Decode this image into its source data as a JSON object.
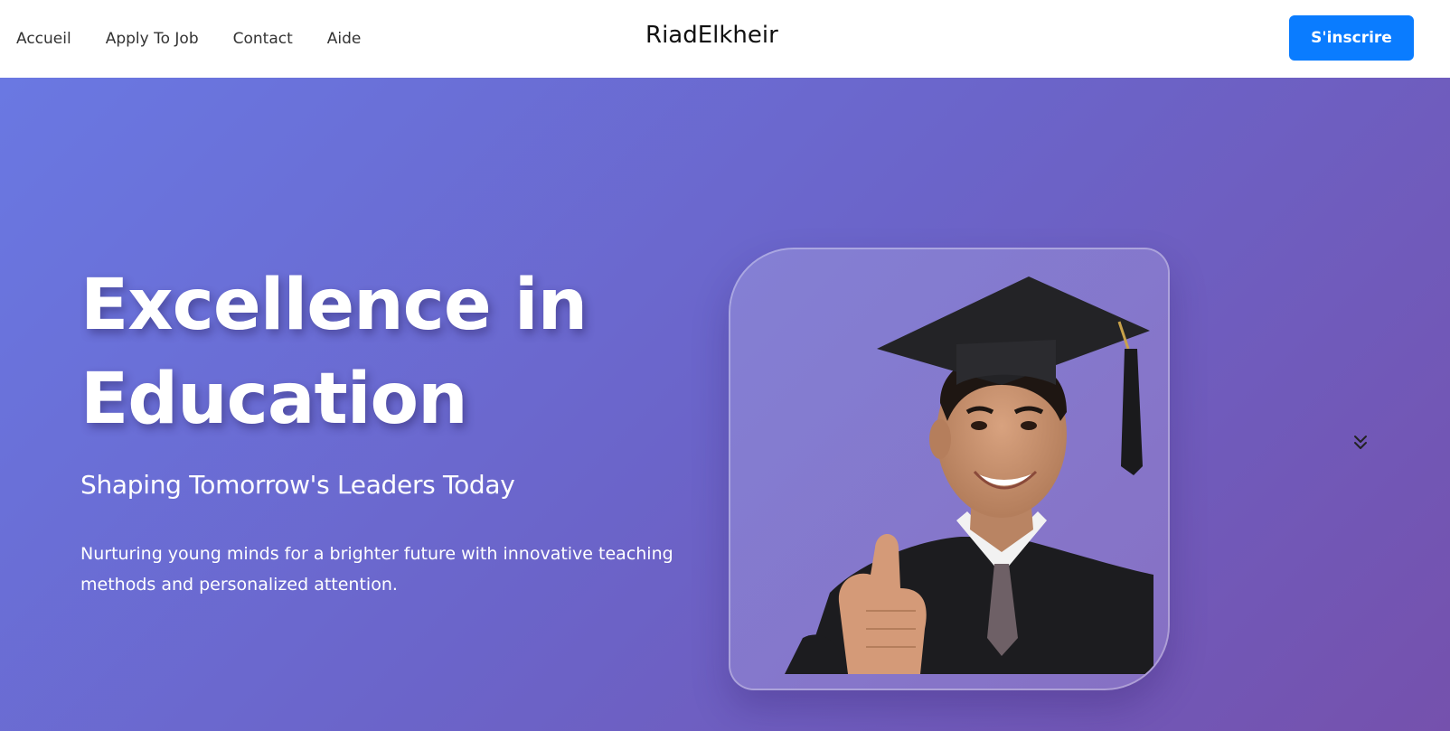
{
  "nav": {
    "links": [
      "Accueil",
      "Apply To Job",
      "Contact",
      "Aide"
    ],
    "brand": "RiadElkheir",
    "signup_label": "S'inscrire"
  },
  "hero": {
    "title": "Excellence in Education",
    "subtitle": "Shaping Tomorrow's Leaders Today",
    "description": "Nurturing young minds for a brighter future with innovative teaching methods and personalized attention."
  },
  "colors": {
    "accent": "#0a7cff",
    "hero_gradient_start": "#6a78e2",
    "hero_gradient_end": "#7551ad"
  },
  "icons": {
    "scroll": "double-chevron-down-icon",
    "photo": "graduate-student-image"
  }
}
